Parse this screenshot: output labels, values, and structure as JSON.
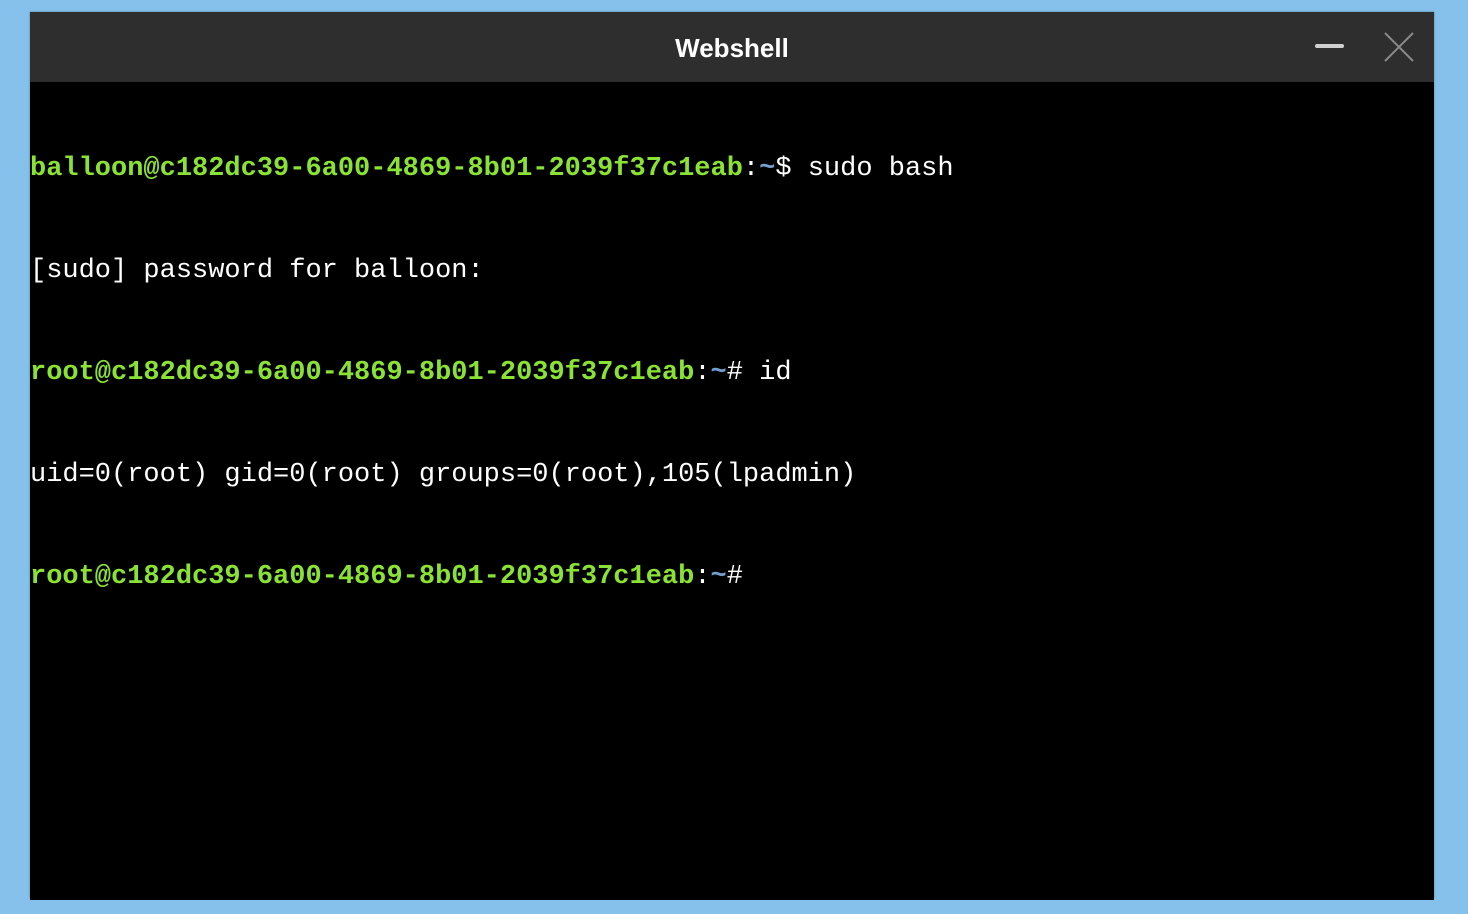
{
  "window": {
    "title": "Webshell",
    "icons": {
      "minimize": "minimize-icon",
      "close": "close-icon"
    }
  },
  "colors": {
    "desktop": "#85c1ea",
    "titlebar": "#2e2e2e",
    "terminal_bg": "#000000",
    "prompt_user": "#8ae234",
    "prompt_path": "#729fcf",
    "text": "#ffffff"
  },
  "terminal": {
    "lines": [
      {
        "type": "prompt",
        "user_host": "balloon@c182dc39-6a00-4869-8b01-2039f37c1eab",
        "sep": ":",
        "path": "~",
        "symbol": "$ ",
        "command": "sudo bash"
      },
      {
        "type": "output",
        "text": "[sudo] password for balloon:"
      },
      {
        "type": "prompt",
        "user_host": "root@c182dc39-6a00-4869-8b01-2039f37c1eab",
        "sep": ":",
        "path": "~",
        "symbol": "# ",
        "command": "id"
      },
      {
        "type": "output",
        "text": "uid=0(root) gid=0(root) groups=0(root),105(lpadmin)"
      },
      {
        "type": "prompt",
        "user_host": "root@c182dc39-6a00-4869-8b01-2039f37c1eab",
        "sep": ":",
        "path": "~",
        "symbol": "#",
        "command": ""
      }
    ]
  }
}
